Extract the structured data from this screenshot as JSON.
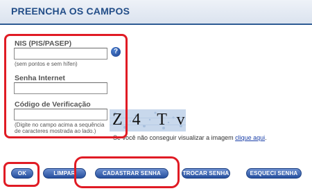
{
  "header": {
    "title": "PREENCHA OS CAMPOS"
  },
  "form": {
    "nis": {
      "label": "NIS (PIS/PASEP)",
      "value": "",
      "hint": "(sem pontos e sem hífen)"
    },
    "senha": {
      "label": "Senha Internet",
      "value": ""
    },
    "codigo": {
      "label": "Código de Verificação",
      "value": "",
      "hint_line1": "(Digite no campo acima a sequência",
      "hint_line2": "de caracteres mostrada ao lado.)"
    },
    "help_icon": "?"
  },
  "captcha": {
    "text": "Z 4  T v",
    "note_prefix": "Se você não conseguir visualizar a imagem ",
    "link_label": "clique aqui",
    "note_suffix": "."
  },
  "buttons": {
    "ok": "OK",
    "limpar": "LIMPAR",
    "cadastrar": "CADASTRAR SENHA",
    "trocar": "TROCAR SENHA",
    "esqueci": "ESQUECI SENHA"
  },
  "colors": {
    "accent": "#2d5a93",
    "highlight": "#e01b24",
    "button": "#254f9e"
  }
}
